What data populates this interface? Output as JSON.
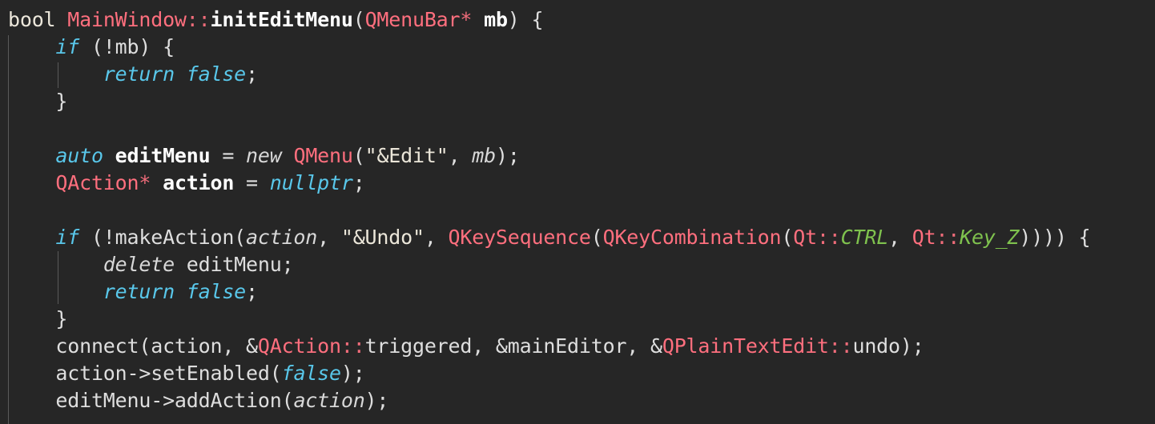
{
  "theme": {
    "background": "#262626",
    "text": "#e2e2e2",
    "type_color": "#ff6f7e",
    "keyword_italic_color": "#59c7ea",
    "enum_color": "#7fc24e"
  },
  "code": {
    "l1": {
      "t1": "bool",
      "t2": " ",
      "t3": "MainWindow",
      "t4": "::",
      "t5": "initEditMenu",
      "t6": "(",
      "t7": "QMenuBar",
      "t8": "*",
      "t9": " ",
      "t10": "mb",
      "t11": ")",
      "t12": " {"
    },
    "l2": {
      "t1": "    ",
      "t2": "if",
      "t3": " (!mb) {"
    },
    "l3": {
      "t1": "        ",
      "t2": "return",
      "t3": " ",
      "t4": "false",
      "t5": ";"
    },
    "l4": {
      "t1": "    }"
    },
    "l6": {
      "t1": "    ",
      "t2": "auto",
      "t3": " ",
      "t4": "editMenu",
      "t5": " = ",
      "t6": "new",
      "t7": " ",
      "t8": "QMenu",
      "t9": "(",
      "t10": "\"&Edit\"",
      "t11": ", ",
      "t12": "mb",
      "t13": ");"
    },
    "l7": {
      "t1": "    ",
      "t2": "QAction",
      "t3": "*",
      "t4": " ",
      "t5": "action",
      "t6": " = ",
      "t7": "nullptr",
      "t8": ";"
    },
    "l9": {
      "t1": "    ",
      "t2": "if",
      "t3": " (!makeAction(",
      "t4": "action",
      "t5": ", ",
      "t6": "\"&Undo\"",
      "t7": ", ",
      "t8": "QKeySequence",
      "t9": "(",
      "t10": "QKeyCombination",
      "t11": "(",
      "t12": "Qt",
      "t13": "::",
      "t14": "CTRL",
      "t15": ", ",
      "t16": "Qt",
      "t17": "::",
      "t18": "Key_Z",
      "t19": ")))) {"
    },
    "l10": {
      "t1": "        ",
      "t2": "delete",
      "t3": " editMenu;"
    },
    "l11": {
      "t1": "        ",
      "t2": "return",
      "t3": " ",
      "t4": "false",
      "t5": ";"
    },
    "l12": {
      "t1": "    }"
    },
    "l13": {
      "t1": "    connect(action, &",
      "t2": "QAction",
      "t3": "::",
      "t4": "triggered, &mainEditor, &",
      "t5": "QPlainTextEdit",
      "t6": "::",
      "t7": "undo);"
    },
    "l14": {
      "t1": "    action->setEnabled(",
      "t2": "false",
      "t3": ");"
    },
    "l15": {
      "t1": "    editMenu->addAction(",
      "t2": "action",
      "t3": ");"
    }
  }
}
